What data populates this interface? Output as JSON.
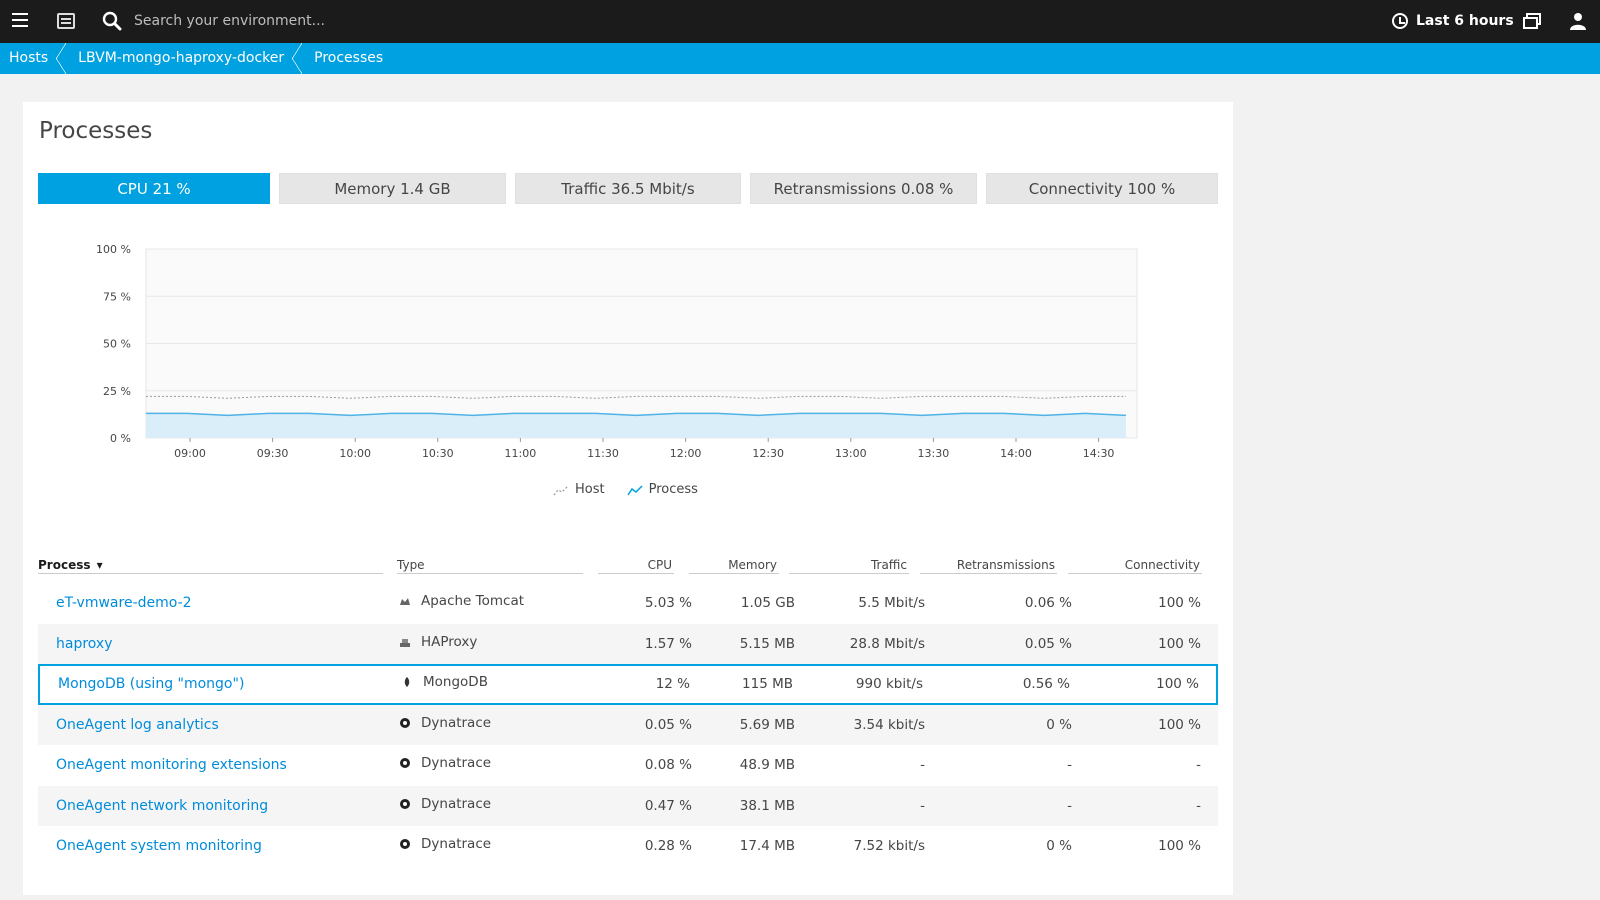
{
  "topbar": {
    "search_placeholder": "Search your environment...",
    "timeframe_label": "Last 6 hours"
  },
  "breadcrumb": [
    "Hosts",
    "LBVM-mongo-haproxy-docker",
    "Processes"
  ],
  "panel": {
    "title": "Processes"
  },
  "metric_tabs": [
    {
      "label": "CPU 21 %",
      "active": true
    },
    {
      "label": "Memory 1.4 GB",
      "active": false
    },
    {
      "label": "Traffic 36.5 Mbit/s",
      "active": false
    },
    {
      "label": "Retransmissions 0.08 %",
      "active": false
    },
    {
      "label": "Connectivity 100 %",
      "active": false
    }
  ],
  "chart_data": {
    "type": "area",
    "y_ticks": [
      "100 %",
      "75 %",
      "50 %",
      "25 %",
      "0 %"
    ],
    "ylim": [
      0,
      100
    ],
    "x_ticks": [
      "09:00",
      "09:30",
      "10:00",
      "10:30",
      "11:00",
      "11:30",
      "12:00",
      "12:30",
      "13:00",
      "13:30",
      "14:00",
      "14:30"
    ],
    "series": [
      {
        "name": "Host",
        "color": "#999999",
        "values": [
          22,
          22,
          21,
          22,
          22,
          21,
          22,
          22,
          21,
          22,
          22,
          21,
          22,
          22,
          22,
          21,
          22,
          22,
          21,
          22,
          22,
          22,
          21,
          22,
          22
        ]
      },
      {
        "name": "Process",
        "color": "#4fb3e6",
        "values": [
          13,
          13,
          12,
          13,
          13,
          12,
          13,
          13,
          12,
          13,
          13,
          13,
          12,
          13,
          13,
          12,
          13,
          13,
          13,
          12,
          13,
          13,
          12,
          13,
          12
        ]
      }
    ],
    "legend": [
      "Host",
      "Process"
    ],
    "grid": true
  },
  "table": {
    "headers": {
      "process": "Process",
      "type": "Type",
      "cpu": "CPU",
      "memory": "Memory",
      "traffic": "Traffic",
      "retransmissions": "Retransmissions",
      "connectivity": "Connectivity"
    },
    "rows": [
      {
        "name": "eT-vmware-demo-2",
        "type": "Apache Tomcat",
        "icon": "tomcat-icon",
        "cpu": "5.03 %",
        "memory": "1.05 GB",
        "traffic": "5.5 Mbit/s",
        "retrans": "0.06 %",
        "conn": "100 %"
      },
      {
        "name": "haproxy",
        "type": "HAProxy",
        "icon": "haproxy-icon",
        "cpu": "1.57 %",
        "memory": "5.15 MB",
        "traffic": "28.8 Mbit/s",
        "retrans": "0.05 %",
        "conn": "100 %"
      },
      {
        "name": "MongoDB (using \"mongo\")",
        "type": "MongoDB",
        "icon": "mongodb-icon",
        "cpu": "12 %",
        "memory": "115 MB",
        "traffic": "990 kbit/s",
        "retrans": "0.56 %",
        "conn": "100 %"
      },
      {
        "name": "OneAgent log analytics",
        "type": "Dynatrace",
        "icon": "dynatrace-icon",
        "cpu": "0.05 %",
        "memory": "5.69 MB",
        "traffic": "3.54 kbit/s",
        "retrans": "0 %",
        "conn": "100 %"
      },
      {
        "name": "OneAgent monitoring extensions",
        "type": "Dynatrace",
        "icon": "dynatrace-icon",
        "cpu": "0.08 %",
        "memory": "48.9 MB",
        "traffic": "-",
        "retrans": "-",
        "conn": "-"
      },
      {
        "name": "OneAgent network monitoring",
        "type": "Dynatrace",
        "icon": "dynatrace-icon",
        "cpu": "0.47 %",
        "memory": "38.1 MB",
        "traffic": "-",
        "retrans": "-",
        "conn": "-"
      },
      {
        "name": "OneAgent system monitoring",
        "type": "Dynatrace",
        "icon": "dynatrace-icon",
        "cpu": "0.28 %",
        "memory": "17.4 MB",
        "traffic": "7.52 kbit/s",
        "retrans": "0 %",
        "conn": "100 %"
      }
    ]
  }
}
